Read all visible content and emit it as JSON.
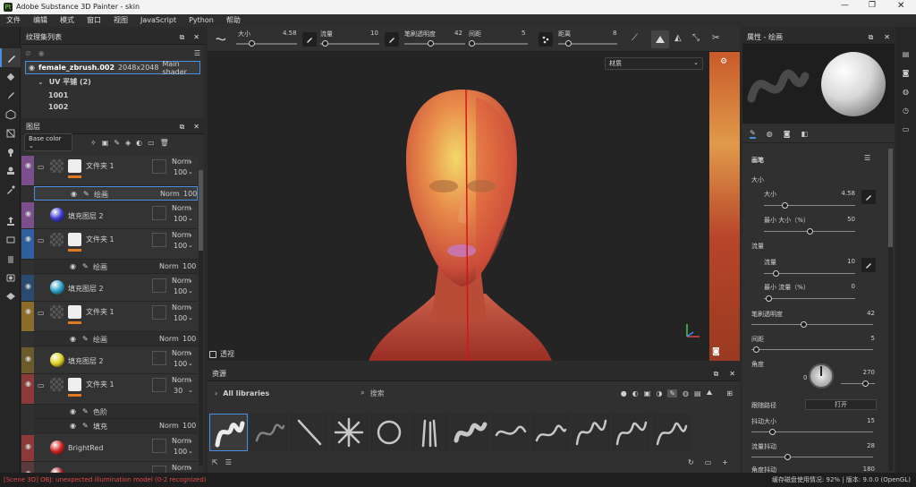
{
  "window": {
    "title": "Adobe Substance 3D Painter - skin"
  },
  "menu": [
    "文件",
    "编辑",
    "模式",
    "窗口",
    "视图",
    "JavaScript",
    "Python",
    "帮助"
  ],
  "brushbar": {
    "size_label": "大小",
    "size_value": "4.58",
    "flow_label": "流量",
    "flow_value": "10",
    "opacity_label": "笔刷透明度",
    "opacity_value": "42",
    "spacing_label": "间距",
    "spacing_value": "5",
    "distance_label": "距离",
    "distance_value": "8"
  },
  "texture_sets": {
    "title": "纹理集列表",
    "item": {
      "name": "female_zbrush.002",
      "resolution": "2048x2048",
      "shader": "Main shader"
    },
    "uv_label": "UV 平铺 (2)",
    "tiles": [
      "1001",
      "1002"
    ]
  },
  "layers": {
    "title": "图层",
    "channel": "Base color",
    "items": [
      {
        "name": "文件夹 1",
        "blend": "Norm",
        "opacity": "100",
        "color": "#7b4f8c"
      },
      {
        "name": "绘画",
        "blend": "Norm",
        "opacity": "100"
      },
      {
        "name": "填充图层 2",
        "blend": "Norm",
        "opacity": "100",
        "color": "#7b4f8c"
      },
      {
        "name": "文件夹 1",
        "blend": "Norm",
        "opacity": "100",
        "color": "#2f5f9e"
      },
      {
        "name": "绘画",
        "blend": "Norm",
        "opacity": "100"
      },
      {
        "name": "填充图层 2",
        "blend": "Norm",
        "opacity": "100",
        "color": "#2a4a6e"
      },
      {
        "name": "文件夹 1",
        "blend": "Norm",
        "opacity": "100",
        "color": "#8a6d2a"
      },
      {
        "name": "绘画",
        "blend": "Norm",
        "opacity": "100"
      },
      {
        "name": "填充图层 2",
        "blend": "Norm",
        "opacity": "100",
        "color": "#6b5a2a"
      },
      {
        "name": "文件夹 1",
        "blend": "Norm",
        "opacity": "30",
        "color": "#8c3a3a"
      },
      {
        "name": "色阶"
      },
      {
        "name": "填充",
        "blend": "Norm",
        "opacity": "100"
      },
      {
        "name": "BrightRed",
        "blend": "Norm",
        "opacity": "100",
        "color": "#8c3a3a"
      },
      {
        "name": "",
        "blend": "Norm",
        "opacity": ""
      }
    ]
  },
  "viewport": {
    "material_dropdown": "材质",
    "label": "透视"
  },
  "assets": {
    "title": "资源",
    "library": "All libraries",
    "search_placeholder": "搜索"
  },
  "properties": {
    "title": "属性 - 绘画",
    "section": "画笔",
    "size_group": "大小",
    "size_label": "大小",
    "size_value": "4.58",
    "min_size_label": "最小 大小（%）",
    "min_size_value": "50",
    "flow_group": "流量",
    "flow_label": "流量",
    "flow_value": "10",
    "min_flow_label": "最小 流量（%）",
    "min_flow_value": "0",
    "opacity_label": "笔刷透明度",
    "opacity_value": "42",
    "spacing_label": "间距",
    "spacing_value": "5",
    "angle_label": "角度",
    "angle_value": "270",
    "angle_zero": "0",
    "follow_path_label": "跟随路径",
    "follow_path_value": "打开",
    "jitter_size_label": "抖动大小",
    "jitter_size_value": "15",
    "jitter_flow_label": "流量抖动",
    "jitter_flow_value": "28",
    "jitter_angle_label": "角度抖动",
    "jitter_angle_value": "180"
  },
  "status": {
    "error": "[Scene 3D] OBJ: unexpected illumination model (0-2 recognized)",
    "right": "缓存磁盘使用情况:  92%  |  版本: 9.0.0 (OpenGL)"
  }
}
